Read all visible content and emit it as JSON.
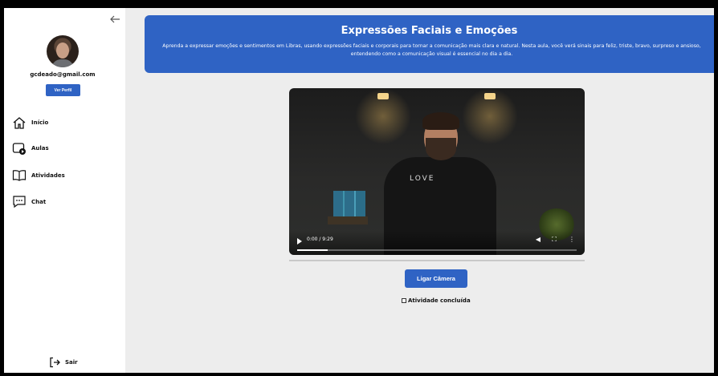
{
  "sidebar": {
    "email": "gcdeado@gmail.com",
    "profile_button": "Ver Perfil",
    "nav": [
      {
        "label": "Início",
        "icon": "home-icon"
      },
      {
        "label": "Aulas",
        "icon": "video-lesson-icon"
      },
      {
        "label": "Atividades",
        "icon": "book-icon"
      },
      {
        "label": "Chat",
        "icon": "chat-icon"
      }
    ],
    "logout": {
      "label": "Sair",
      "icon": "logout-icon"
    },
    "collapse_icon": "arrow-left-icon"
  },
  "header": {
    "title": "Expressões Faciais e Emoções",
    "description": "Aprenda a expressar emoções e sentimentos em Libras, usando expressões faciais e corporais para tornar a comunicação mais clara e natural. Nesta aula, você verá sinais para feliz, triste, bravo, surpreso e ansioso, entendendo como a comunicação visual é essencial no dia a dia."
  },
  "video": {
    "time": "0:00 / 9:29",
    "progress": 0.11,
    "shirt_print": "LOVE"
  },
  "actions": {
    "camera_button": "Ligar Câmera",
    "completed_label": "Atividade concluída",
    "completed_checked": false
  },
  "colors": {
    "accent": "#2f63c4",
    "background": "#ededed",
    "sidebar": "#ffffff"
  }
}
